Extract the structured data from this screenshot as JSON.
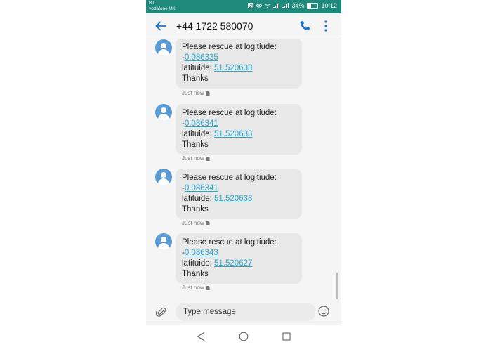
{
  "status_bar": {
    "carrier_line1": "BT",
    "carrier_line2": "vodafone UK",
    "battery_percent": "34%",
    "battery_level": 0.34,
    "time": "10:12"
  },
  "header": {
    "contact": "+44 1722 580070",
    "icons": [
      "back-arrow-icon",
      "phone-icon",
      "more-vertical-icon"
    ]
  },
  "messages": [
    {
      "line1": "Please rescue at logitiude:",
      "lon_prefix": "-",
      "lon": "0.086335",
      "lat_label": "latituide: ",
      "lat": "51.520638",
      "closing": "Thanks",
      "time": "Just now"
    },
    {
      "line1": "Please rescue at logitiude:",
      "lon_prefix": "-",
      "lon": "0.086341",
      "lat_label": "latituide: ",
      "lat": "51.520633",
      "closing": "Thanks",
      "time": "Just now"
    },
    {
      "line1": "Please rescue at logitiude:",
      "lon_prefix": "-",
      "lon": "0.086341",
      "lat_label": "latituide: ",
      "lat": "51.520633",
      "closing": "Thanks",
      "time": "Just now"
    },
    {
      "line1": "Please rescue at logitiude:",
      "lon_prefix": "-",
      "lon": "0.086343",
      "lat_label": "latituide: ",
      "lat": "51.520627",
      "closing": "Thanks",
      "time": "Just now"
    }
  ],
  "compose": {
    "placeholder": "Type message"
  },
  "colors": {
    "status_bar": "#1f8a7c",
    "accent": "#1a73c9",
    "link": "#2aa7c9",
    "bubble": "#e8e8e8",
    "avatar": "#5b9bd5"
  }
}
